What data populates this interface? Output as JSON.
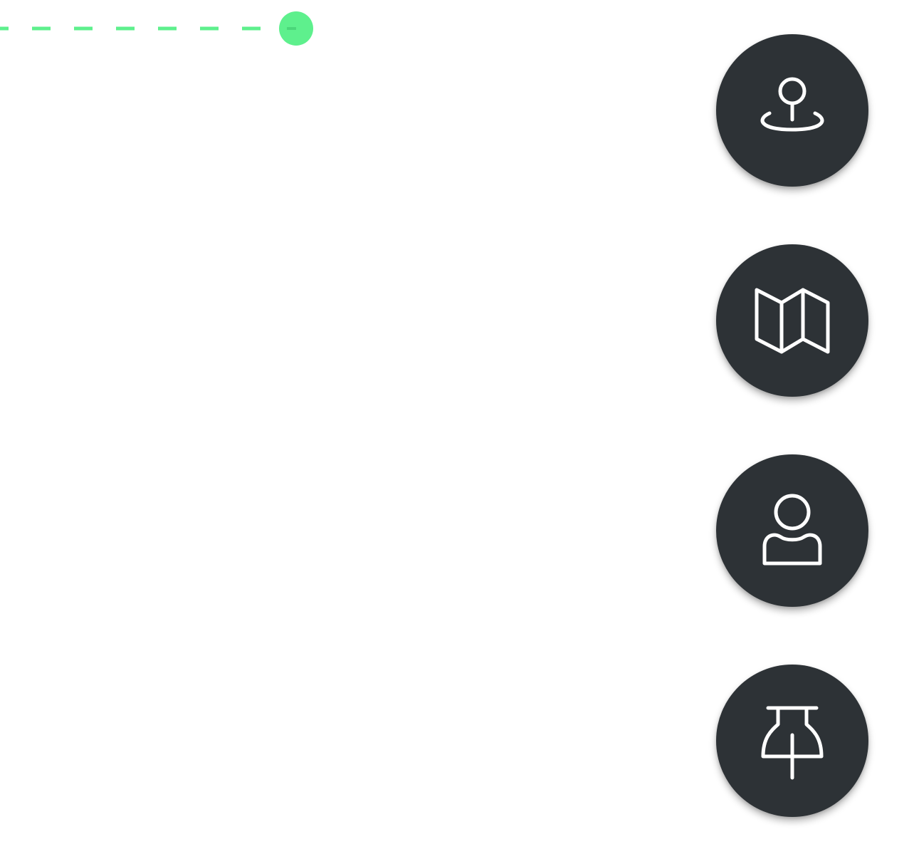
{
  "colors": {
    "background": "#ffffff",
    "fab_background": "#2d3236",
    "icon_stroke": "#ffffff",
    "route_accent": "#5ef08d"
  },
  "route": {
    "endpoint_icon": "route-endpoint-dot"
  },
  "fabs": [
    {
      "icon": "location-pin-icon",
      "name": "location-pin-button"
    },
    {
      "icon": "map-icon",
      "name": "map-button"
    },
    {
      "icon": "user-icon",
      "name": "user-button"
    },
    {
      "icon": "pushpin-icon",
      "name": "pushpin-button"
    }
  ]
}
